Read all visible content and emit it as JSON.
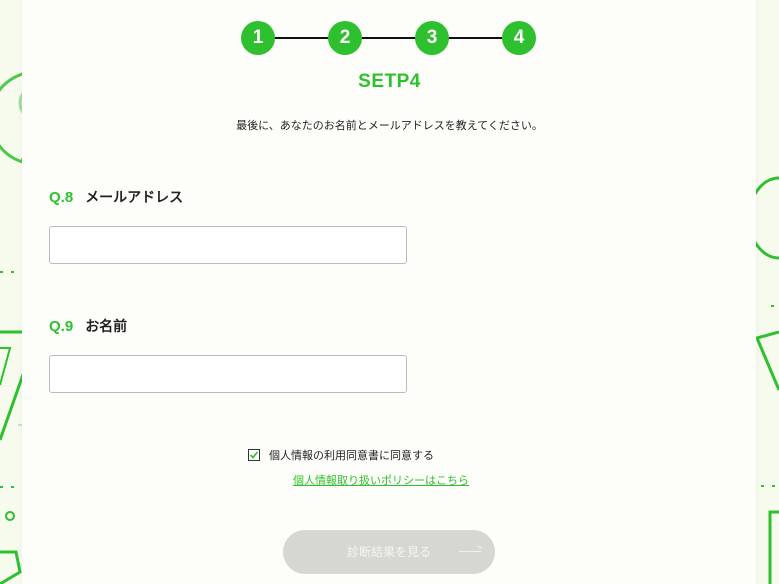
{
  "steps": {
    "items": [
      "1",
      "2",
      "3",
      "4"
    ],
    "title": "SETP4"
  },
  "instruction": "最後に、あなたのお名前とメールアドレスを教えてください。",
  "questions": [
    {
      "number": "Q.8",
      "label": "メールアドレス",
      "value": "",
      "placeholder": ""
    },
    {
      "number": "Q.9",
      "label": "お名前",
      "value": "",
      "placeholder": ""
    }
  ],
  "consent": {
    "checked": true,
    "label": "個人情報の利用同意書に同意する",
    "policy_link": "個人情報取り扱いポリシーはこちら"
  },
  "submit": {
    "label": "診断結果を見る"
  },
  "colors": {
    "accent": "#2ec02e",
    "page_bg": "#f7fbee",
    "card_bg": "#fdfef9",
    "button_disabled": "#d6d6d3"
  },
  "icons": {
    "background_decor": [
      "lightbulb-icon",
      "triangle-icon",
      "pencil-icon",
      "circle-icon",
      "plus-icon"
    ],
    "checkbox": "checkmark-icon",
    "button": "arrow-right-icon"
  }
}
